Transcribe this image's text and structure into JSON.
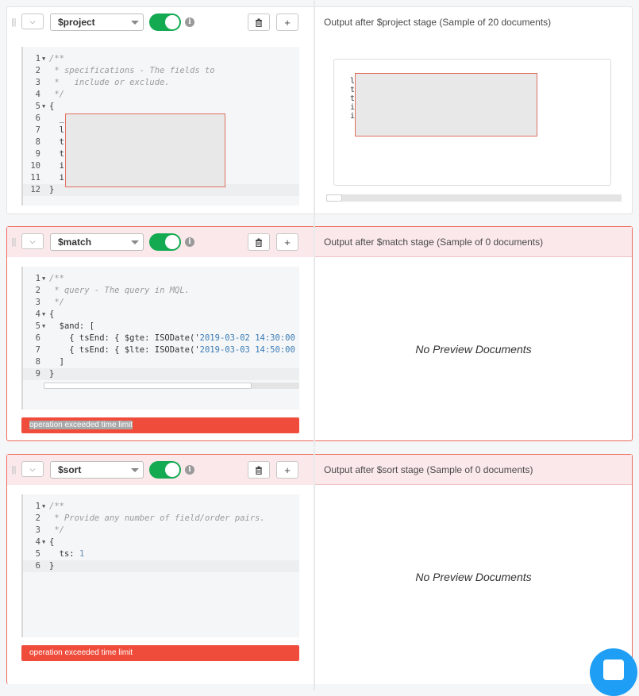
{
  "stages": [
    {
      "operator": "$project",
      "output_header": "Output after $project stage (Sample of 20 documents)",
      "code": [
        {
          "n": "1",
          "fold": true,
          "text": "/**",
          "cls": "cm"
        },
        {
          "n": "2",
          "fold": false,
          "text": " * specifications - The fields to",
          "cls": "cm"
        },
        {
          "n": "3",
          "fold": false,
          "text": " *   include or exclude.",
          "cls": "cm"
        },
        {
          "n": "4",
          "fold": false,
          "text": " */",
          "cls": "cm"
        },
        {
          "n": "5",
          "fold": true,
          "text": "{",
          "cls": ""
        },
        {
          "n": "6",
          "fold": false,
          "text": "  _",
          "cls": ""
        },
        {
          "n": "7",
          "fold": false,
          "text": "  l",
          "cls": ""
        },
        {
          "n": "8",
          "fold": false,
          "text": "  t",
          "cls": ""
        },
        {
          "n": "9",
          "fold": false,
          "text": "  t",
          "cls": ""
        },
        {
          "n": "10",
          "fold": false,
          "text": "  i",
          "cls": ""
        },
        {
          "n": "11",
          "fold": false,
          "text": "  i",
          "cls": ""
        },
        {
          "n": "12",
          "fold": false,
          "text": "}",
          "cls": ""
        }
      ],
      "preview_lines": [
        "l",
        "t",
        "t",
        "i",
        "i"
      ],
      "error": "",
      "no_preview": ""
    },
    {
      "operator": "$match",
      "output_header": "Output after $match stage (Sample of 0 documents)",
      "code": [
        {
          "n": "1",
          "fold": true,
          "text": "/**",
          "cls": "cm"
        },
        {
          "n": "2",
          "fold": false,
          "text": " * query - The query in MQL.",
          "cls": "cm"
        },
        {
          "n": "3",
          "fold": false,
          "text": " */",
          "cls": "cm"
        },
        {
          "n": "4",
          "fold": true,
          "text": "{",
          "cls": ""
        },
        {
          "n": "5",
          "fold": true,
          "text": "  $and: [",
          "cls": ""
        },
        {
          "n": "6",
          "fold": false,
          "text": "    { tsEnd: { $gte: ISODate('",
          "cls": "",
          "str": "2019-03-02 14:30:00"
        },
        {
          "n": "7",
          "fold": false,
          "text": "    { tsEnd: { $lte: ISODate('",
          "cls": "",
          "str": "2019-03-03 14:50:00"
        },
        {
          "n": "8",
          "fold": false,
          "text": "  ]",
          "cls": ""
        },
        {
          "n": "9",
          "fold": false,
          "text": "}",
          "cls": ""
        }
      ],
      "error": "operation exceeded time limit",
      "no_preview": "No Preview Documents"
    },
    {
      "operator": "$sort",
      "output_header": "Output after $sort stage (Sample of 0 documents)",
      "code": [
        {
          "n": "1",
          "fold": true,
          "text": "/**",
          "cls": "cm"
        },
        {
          "n": "2",
          "fold": false,
          "text": " * Provide any number of field/order pairs.",
          "cls": "cm"
        },
        {
          "n": "3",
          "fold": false,
          "text": " */",
          "cls": "cm"
        },
        {
          "n": "4",
          "fold": true,
          "text": "{",
          "cls": ""
        },
        {
          "n": "5",
          "fold": false,
          "text": "  ts: ",
          "cls": "",
          "num": "1"
        },
        {
          "n": "6",
          "fold": false,
          "text": "}",
          "cls": ""
        }
      ],
      "error": "operation exceeded time limit",
      "no_preview": "No Preview Documents"
    }
  ],
  "icons": {
    "grip": "drag-handle-icon",
    "collapse": "chevron-down-icon",
    "info": "info-icon",
    "delete": "trash-icon",
    "add": "plus-icon",
    "chat": "chat-icon"
  },
  "colors": {
    "toggle_on": "#13aa52",
    "error": "#ef4c3c",
    "chat": "#1f9ef5"
  }
}
